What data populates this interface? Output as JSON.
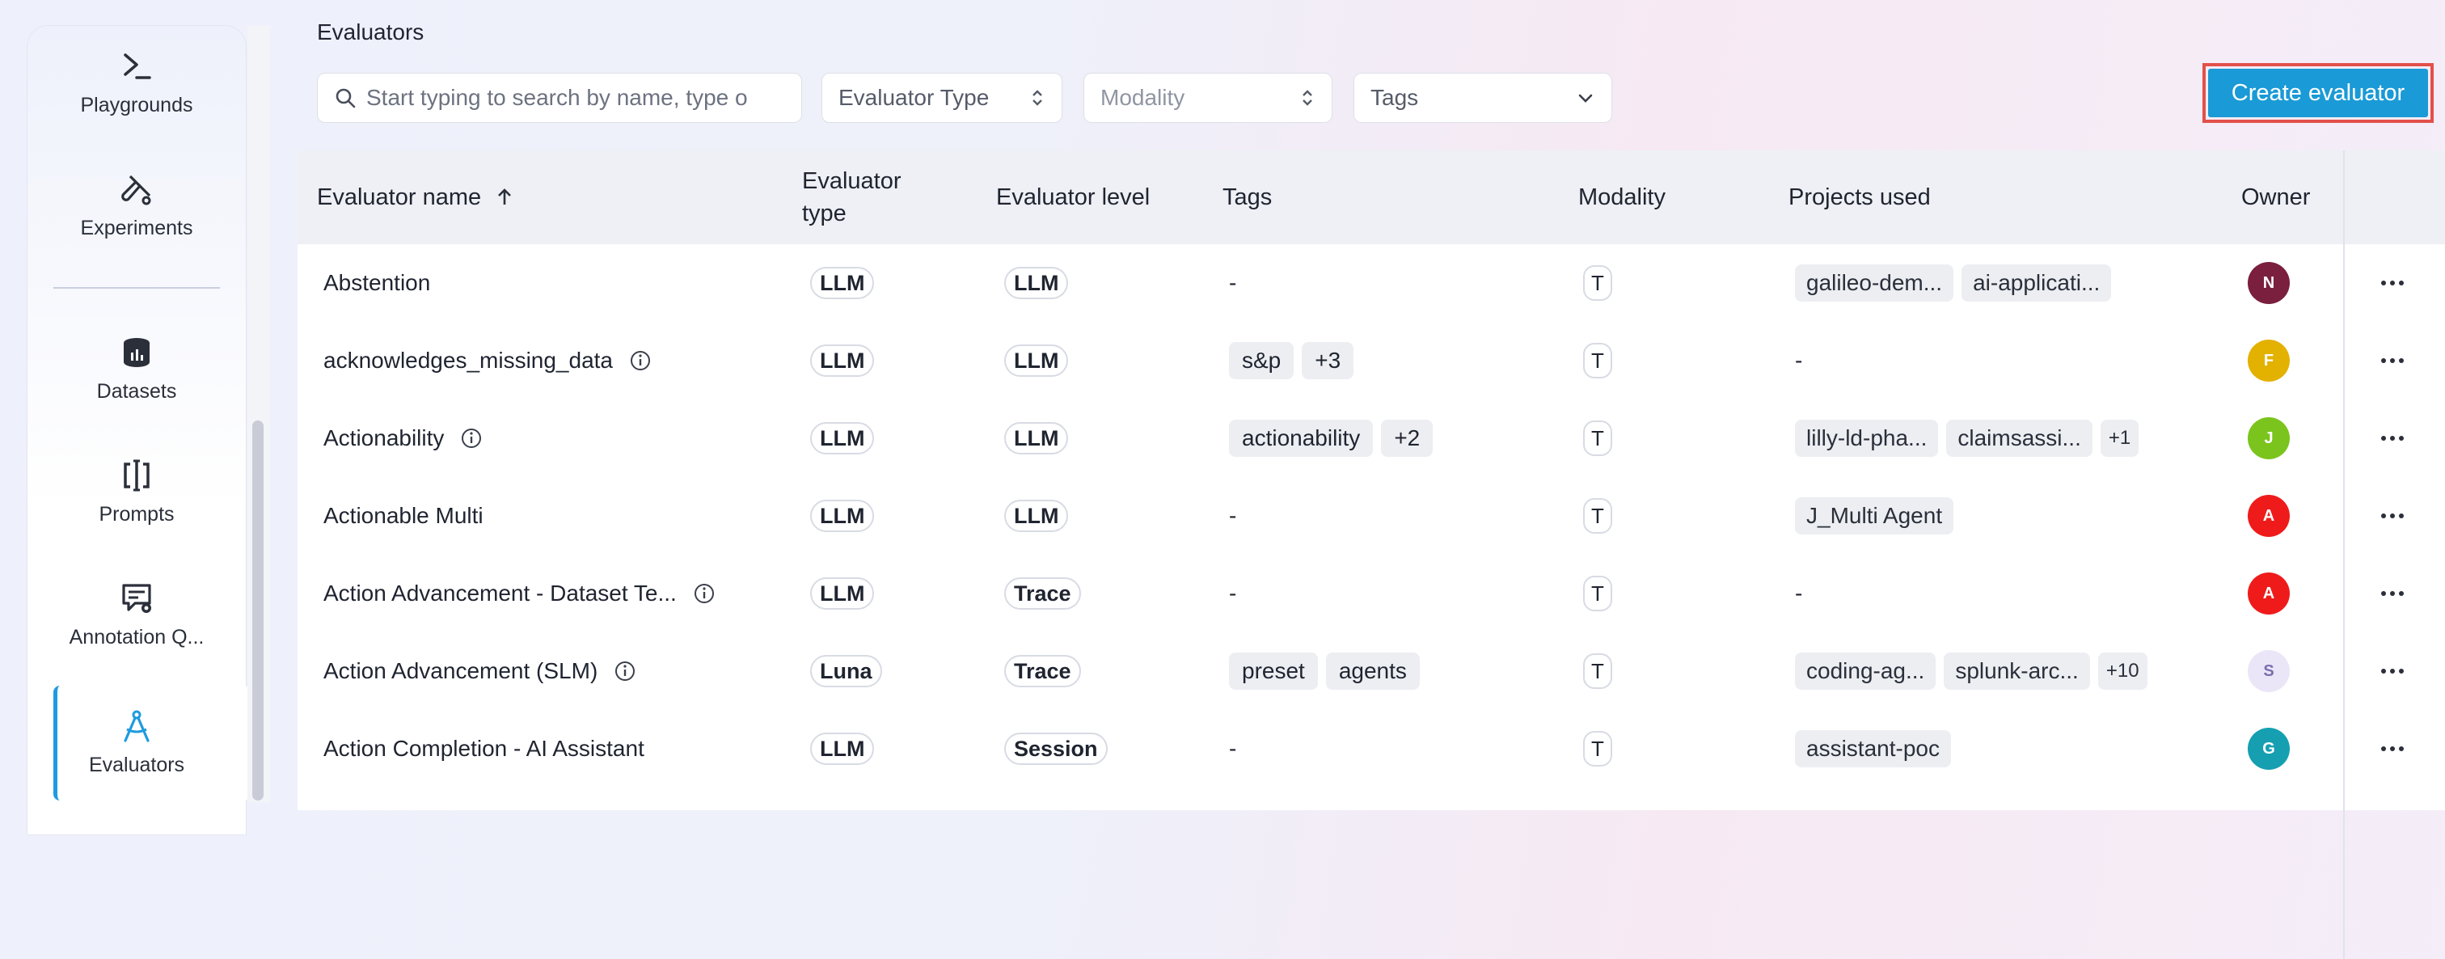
{
  "sidebar": {
    "items": [
      {
        "label": "Playgrounds",
        "icon": "terminal-icon"
      },
      {
        "label": "Experiments",
        "icon": "flask-icon"
      },
      {
        "label": "Datasets",
        "icon": "database-icon"
      },
      {
        "label": "Prompts",
        "icon": "text-cursor-icon"
      },
      {
        "label": "Annotation Q...",
        "icon": "annotation-queue-icon"
      },
      {
        "label": "Evaluators",
        "icon": "evaluators-icon",
        "active": true
      }
    ]
  },
  "header": {
    "title": "Evaluators",
    "search_placeholder": "Start typing to search by name, type o",
    "filter_type": "Evaluator Type",
    "filter_modality": "Modality",
    "filter_tags": "Tags",
    "create_label": "Create evaluator"
  },
  "table": {
    "columns": {
      "name": "Evaluator name",
      "type_line1": "Evaluator",
      "type_line2": "type",
      "level": "Evaluator level",
      "tags": "Tags",
      "modality": "Modality",
      "projects": "Projects used",
      "owner": "Owner"
    },
    "rows": [
      {
        "name": "Abstention",
        "type": "LLM",
        "level": "LLM",
        "tags": "-",
        "modality": "T",
        "projects": [
          "galileo-dem...",
          "ai-applicati..."
        ],
        "owner": "N"
      },
      {
        "name": "acknowledges_missing_data",
        "type": "LLM",
        "level": "LLM",
        "tags": [
          "s&p",
          "+3"
        ],
        "modality": "T",
        "projects": "-",
        "owner": "F"
      },
      {
        "name": "Actionability",
        "type": "LLM",
        "level": "LLM",
        "tags": [
          "actionability",
          "+2"
        ],
        "modality": "T",
        "projects": [
          "lilly-ld-pha...",
          "claimsassi...",
          "+1"
        ],
        "owner": "J"
      },
      {
        "name": "Actionable Multi",
        "type": "LLM",
        "level": "LLM",
        "tags": "-",
        "modality": "T",
        "projects": [
          "J_Multi Agent"
        ],
        "owner": "A"
      },
      {
        "name": "Action Advancement - Dataset Te...",
        "type": "LLM",
        "level": "Trace",
        "tags": "-",
        "modality": "T",
        "projects": "-",
        "owner": "A"
      },
      {
        "name": "Action Advancement (SLM)",
        "type": "Luna",
        "level": "Trace",
        "tags": [
          "preset",
          "agents"
        ],
        "modality": "T",
        "projects": [
          "coding-ag...",
          "splunk-arc...",
          "+10"
        ],
        "owner": "S"
      },
      {
        "name": "Action Completion - AI Assistant",
        "type": "LLM",
        "level": "Session",
        "tags": "-",
        "modality": "T",
        "projects": [
          "assistant-poc"
        ],
        "owner": "G"
      }
    ]
  },
  "colors": {
    "accent": "#1a9ad6",
    "highlight_border": "#e2504a",
    "avatar_N": "#7a1f3d",
    "avatar_F": "#e3b100",
    "avatar_J": "#7bc41d",
    "avatar_A": "#ef1b1b",
    "avatar_S": "#ebe6f7",
    "avatar_G": "#159fb0"
  }
}
